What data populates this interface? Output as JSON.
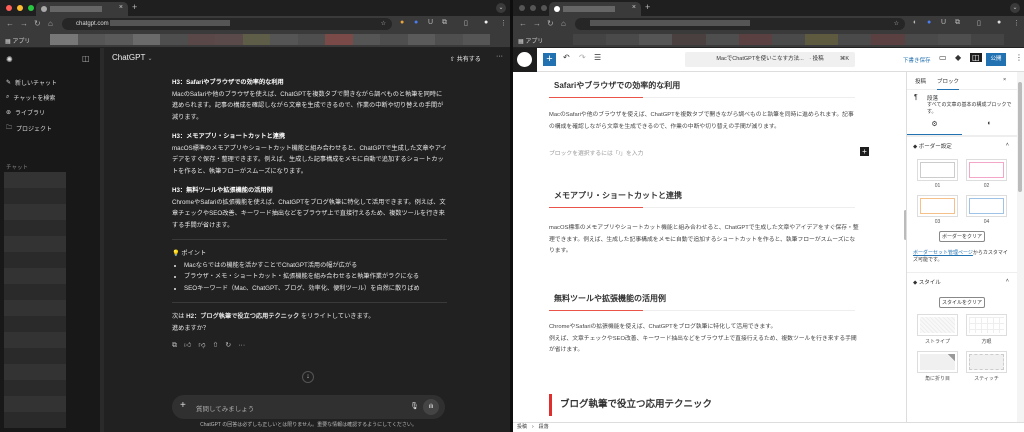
{
  "left": {
    "url": "chatgpt.com",
    "bookmarks_apps": "アプリ",
    "sidebar": {
      "new_chat": "新しいチャット",
      "search": "チャットを検索",
      "library": "ライブラリ",
      "projects": "プロジェクト",
      "section_label": "チャット"
    },
    "header": {
      "model": "ChatGPT",
      "share": "共有する"
    },
    "message": {
      "sections": [
        {
          "title": "H3：Safariやブラウザでの効率的な利用",
          "body": "MacのSafariや他のブラウザを使えば、ChatGPTを複数タブで開きながら調べものと執筆を同時に進められます。記事の構成を確認しながら文章を生成できるので、作業の中断や切り替えの手間が減ります。"
        },
        {
          "title": "H3：メモアプリ・ショートカットと連携",
          "body": "macOS標準のメモアプリやショートカット機能と組み合わせると、ChatGPTで生成した文章やアイデアをすぐ保存・整理できます。例えば、生成した記事構成をメモに自動で追加するショートカットを作ると、執筆フローがスムーズになります。"
        },
        {
          "title": "H3：無料ツールや拡張機能の活用例",
          "body": "ChromeやSafariの拡張機能を使えば、ChatGPTをブログ執筆に特化して活用できます。例えば、文章チェックやSEO改善、キーワード抽出などをブラウザ上で直接行えるため、複数ツールを行き来する手間が省けます。"
        }
      ],
      "point_label": "💡 ポイント",
      "points": [
        "Macならではの機能を活かすことでChatGPT活用の幅が広がる",
        "ブラウザ・メモ・ショートカット・拡張機能を組み合わせると執筆作業がラクになる",
        "SEOキーワード（Mac、ChatGPT、ブログ、効率化、便利ツール）を自然に散りばめ"
      ],
      "next_prefix": "次は ",
      "next_bold": "H2：ブログ執筆で役立つ応用テクニック",
      "next_suffix": " をリライトしていきます。",
      "question": "進めますか？"
    },
    "input_placeholder": "質問してみましょう",
    "disclaimer": "ChatGPT の回答は必ずしも正しいとは限りません。重要な情報は確認するようにしてください。"
  },
  "right": {
    "bookmarks_apps": "アプリ",
    "toolbar": {
      "command": "MacでChatGPTを使いこなす方法...　· 投稿",
      "shortcut": "⌘K",
      "save_draft": "下書き保存",
      "publish": "公開"
    },
    "editor": {
      "h2_1": "Safariやブラウザでの効率的な利用",
      "p1": "MacのSafariや他のブラウザを使えば、ChatGPTを複数タブで開きながら調べものと執筆を同時に進められます。記事の構成を確認しながら文章を生成できるので、作業の中断や切り替えの手間が減ります。",
      "placeholder": "ブロックを選択するには「/」を入力",
      "h2_2": "メモアプリ・ショートカットと連携",
      "p2": "macOS標準のメモアプリやショートカット機能と組み合わせると、ChatGPTで生成した文章やアイデアをすぐ保存・整理できます。例えば、生成した記事構成をメモに自動で追加するショートカットを作ると、執筆フローがスムーズになります。",
      "h2_3": "無料ツールや拡張機能の活用例",
      "p3a": "ChromeやSafariの拡張機能を使えば、ChatGPTをブログ執筆に特化して活用できます。",
      "p3b": "例えば、文章チェックやSEO改善、キーワード抽出などをブラウザ上で直接行えるため、複数ツールを行き来する手間が省けます。",
      "h2_4": "ブログ執筆で役立つ応用テクニック"
    },
    "breadcrumb": "投稿　›　段落",
    "sidebar": {
      "tab_post": "投稿",
      "tab_block": "ブロック",
      "block_name": "段落",
      "block_desc": "すべての文章の基本の構成ブロックです。",
      "border_title": "ボーダー設定",
      "borders": [
        {
          "label": "01",
          "color": "#cccccc"
        },
        {
          "label": "02",
          "color": "#f4a6c8"
        },
        {
          "label": "03",
          "color": "#f5c08a"
        },
        {
          "label": "04",
          "color": "#9fc3e6"
        }
      ],
      "clear_border": "ボーダーをクリア",
      "link_text": "ボーダーセット管理ページ",
      "link_suffix": "からカスタマイズ可能です。",
      "style_title": "スタイル",
      "clear_style": "スタイルをクリア",
      "styles": [
        "ストライプ",
        "方眼",
        "角に折り目",
        "スティッチ"
      ]
    }
  }
}
